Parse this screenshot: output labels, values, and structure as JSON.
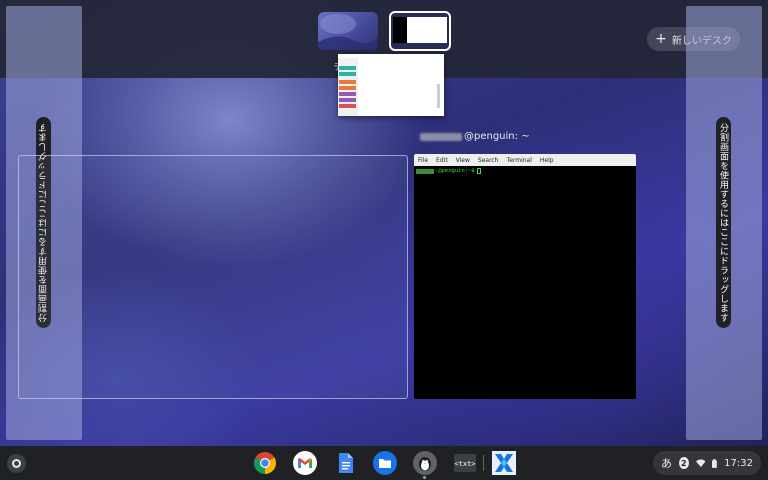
{
  "overview": {
    "desks": [
      {
        "label": "デ",
        "selected": false
      },
      {
        "label": "",
        "selected": true
      }
    ],
    "new_desk_label": "新しいデスク",
    "split_hint_left": "分割画面を使用するにはここにドラッグします",
    "split_hint_right": "分割画面を使用するにはここにドラッグします"
  },
  "terminal_window": {
    "title": "@penguin: ~",
    "menu": [
      "File",
      "Edit",
      "View",
      "Search",
      "Terminal",
      "Help"
    ],
    "prompt": ":@penguin:~$ "
  },
  "shelf": {
    "apps": [
      {
        "name": "Chrome",
        "icon": "chrome-icon"
      },
      {
        "name": "Gmail",
        "icon": "gmail-icon"
      },
      {
        "name": "Docs",
        "icon": "docs-icon"
      },
      {
        "name": "Files",
        "icon": "files-icon"
      },
      {
        "name": "Linux",
        "icon": "penguin-icon"
      },
      {
        "name": "Text",
        "icon": "text-editor-icon"
      },
      {
        "name": "App",
        "icon": "x-app-icon"
      }
    ],
    "tray": {
      "ime": "あ",
      "notification_count": "2",
      "time": "17:32"
    }
  },
  "colors": {
    "accent_blue": "#1a73e8",
    "terminal_green": "#4fd34f"
  }
}
